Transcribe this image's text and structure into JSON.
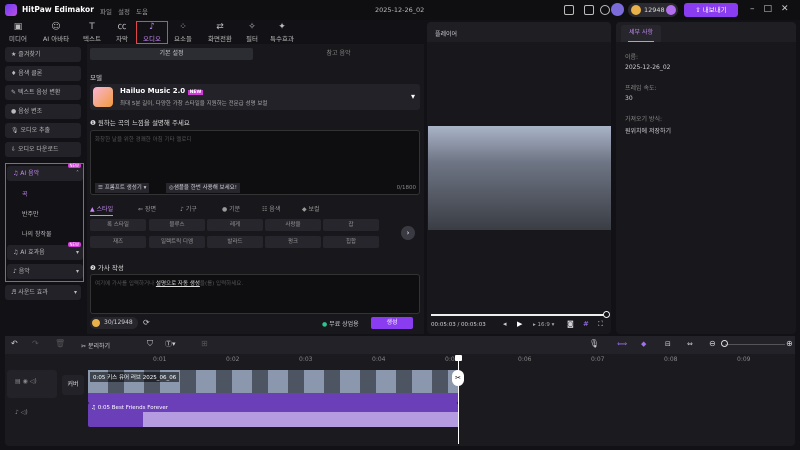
{
  "app": {
    "title": "HitPaw Edimakor",
    "menus": [
      "파일",
      "설정",
      "도움"
    ],
    "date": "2025-12-26_02",
    "coins": "12948",
    "export": "내보내기"
  },
  "tabs": [
    {
      "label": "미디어",
      "icon": "media"
    },
    {
      "label": "AI 아바타",
      "icon": "avatar"
    },
    {
      "label": "텍스트",
      "icon": "text"
    },
    {
      "label": "자막",
      "icon": "subtitle"
    },
    {
      "label": "오디오",
      "icon": "music-note",
      "active": true
    },
    {
      "label": "요소들",
      "icon": "elements"
    },
    {
      "label": "화면전환",
      "icon": "transition"
    },
    {
      "label": "필터",
      "icon": "filter"
    },
    {
      "label": "특수효과",
      "icon": "effects"
    }
  ],
  "sidebar": {
    "items": [
      "즐겨찾기",
      "음색 클론",
      "텍스트 음성 변환",
      "음성 변조",
      "오디오 추출",
      "오디오 다운로드"
    ],
    "ai_music": "AI 음악",
    "new": "NEW",
    "sub": [
      "곡",
      "반주만",
      "나의 창작물"
    ],
    "ai_sfx": "AI 효과음",
    "music": "음악",
    "sound_fx": "사운드 효과"
  },
  "panel": {
    "tabs": [
      "기본 설정",
      "참고 음악"
    ],
    "model_label": "모델",
    "model_name": "Hailuo Music 2.0",
    "model_badge": "NEW",
    "model_desc": "최대 5분 길이, 다양한 가창 스타일을 지원하는 전문급 성명 보컬",
    "step1": "원하는 곡의 느낌을 설명해 주세요",
    "step1_placeholder": "화창한 날을 위한 경쾌한 아침 기타 멜로디",
    "prompt_gen": "프롬프트 생성기",
    "try_sample": "샘플을 한번 사용해 보세요!",
    "count": "0/1800",
    "style_tabs": [
      "스타일",
      "장면",
      "기구",
      "기분",
      "음색",
      "보컬"
    ],
    "chips": [
      "록 스타일",
      "블루스",
      "레게",
      "사랑을",
      "잡",
      "재즈",
      "일렉트릭 디엠",
      "발라드",
      "펑크",
      "힙합"
    ],
    "step2": "가사 작성",
    "lyrics_placeholder_a": "여기에 가사를 입력하거나 ",
    "lyrics_link": "설명으로 자동 생성",
    "lyrics_placeholder_b": "을(를) 입력하세요.",
    "credits": "30/12948",
    "free_commercial": "무료 상업용",
    "generate": "생성"
  },
  "player": {
    "title": "플레이어",
    "time": "00:05:03 / 00:05:03",
    "ratio": "16:9",
    "progress": 1.0
  },
  "details": {
    "tab": "세부 사항",
    "name_label": "이름:",
    "name": "2025-12-26_02",
    "fps_label": "프레임 속도:",
    "fps": "30",
    "import_label": "가져오기 방식:",
    "import": "원위치에 저장하기"
  },
  "timeline": {
    "split": "분리하기",
    "ruler": [
      "0:01",
      "0:02",
      "0:03",
      "0:04",
      "0:05",
      "0:06",
      "0:07",
      "0:08",
      "0:09"
    ],
    "cover": "커버",
    "video_clip": "0:05 키스 유어 러브 2025_06_06",
    "audio_clip": "0:05 Best Friends Forever"
  }
}
